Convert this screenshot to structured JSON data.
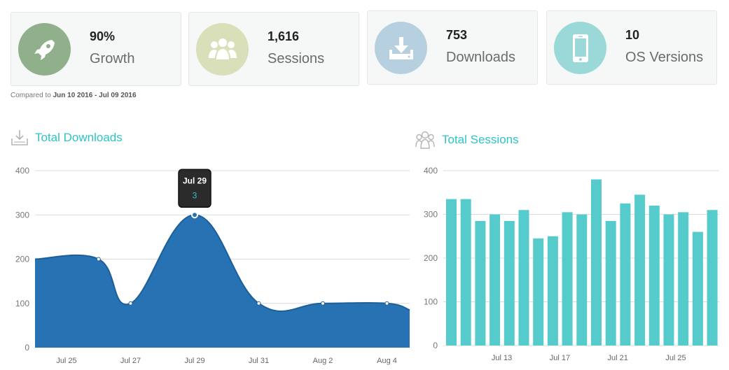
{
  "stats": [
    {
      "value": "90%",
      "label": "Growth",
      "icon": "rocket-icon",
      "color": "#8fb08a"
    },
    {
      "value": "1,616",
      "label": "Sessions",
      "icon": "users-icon",
      "color": "#d9dfb8"
    },
    {
      "value": "753",
      "label": "Downloads",
      "icon": "download-icon",
      "color": "#b6d0df"
    },
    {
      "value": "10",
      "label": "OS Versions",
      "icon": "mobile-icon",
      "color": "#9bd9d9"
    }
  ],
  "compare": {
    "prefix": "Compared to ",
    "range": "Jun 10 2016 - Jul 09 2016"
  },
  "downloads_title": "Total Downloads",
  "sessions_title": "Total Sessions",
  "tooltip": {
    "date": "Jul 29",
    "value": "3"
  },
  "chart_data": [
    {
      "type": "area",
      "title": "Total Downloads",
      "x_ticks": [
        "Jul 25",
        "Jul 27",
        "Jul 29",
        "Jul 31",
        "Aug 2",
        "Aug 4"
      ],
      "y_ticks": [
        0,
        100,
        200,
        300,
        400
      ],
      "ylim": [
        0,
        400
      ],
      "grid": true,
      "color": "#2672b3",
      "points": [
        {
          "x": "Jul 24",
          "y": 200
        },
        {
          "x": "Jul 26",
          "y": 200
        },
        {
          "x": "Jul 27",
          "y": 100
        },
        {
          "x": "Jul 29",
          "y": 300
        },
        {
          "x": "Jul 31",
          "y": 100
        },
        {
          "x": "Aug 2",
          "y": 100
        },
        {
          "x": "Aug 4",
          "y": 100
        },
        {
          "x": "Aug 5",
          "y": 85
        }
      ]
    },
    {
      "type": "bar",
      "title": "Total Sessions",
      "x_ticks": [
        "Jul 13",
        "Jul 17",
        "Jul 21",
        "Jul 25"
      ],
      "y_ticks": [
        0,
        100,
        200,
        300,
        400
      ],
      "ylim": [
        0,
        400
      ],
      "grid": true,
      "color": "#55cbcc",
      "categories": [
        "Jul 10",
        "Jul 11",
        "Jul 12",
        "Jul 13",
        "Jul 14",
        "Jul 15",
        "Jul 16",
        "Jul 17",
        "Jul 18",
        "Jul 19",
        "Jul 20",
        "Jul 21",
        "Jul 22",
        "Jul 23",
        "Jul 24",
        "Jul 25",
        "Jul 26",
        "Jul 27",
        "Jul 28"
      ],
      "values": [
        335,
        335,
        285,
        300,
        285,
        310,
        245,
        250,
        305,
        300,
        380,
        285,
        325,
        345,
        320,
        300,
        305,
        260,
        310
      ]
    }
  ]
}
